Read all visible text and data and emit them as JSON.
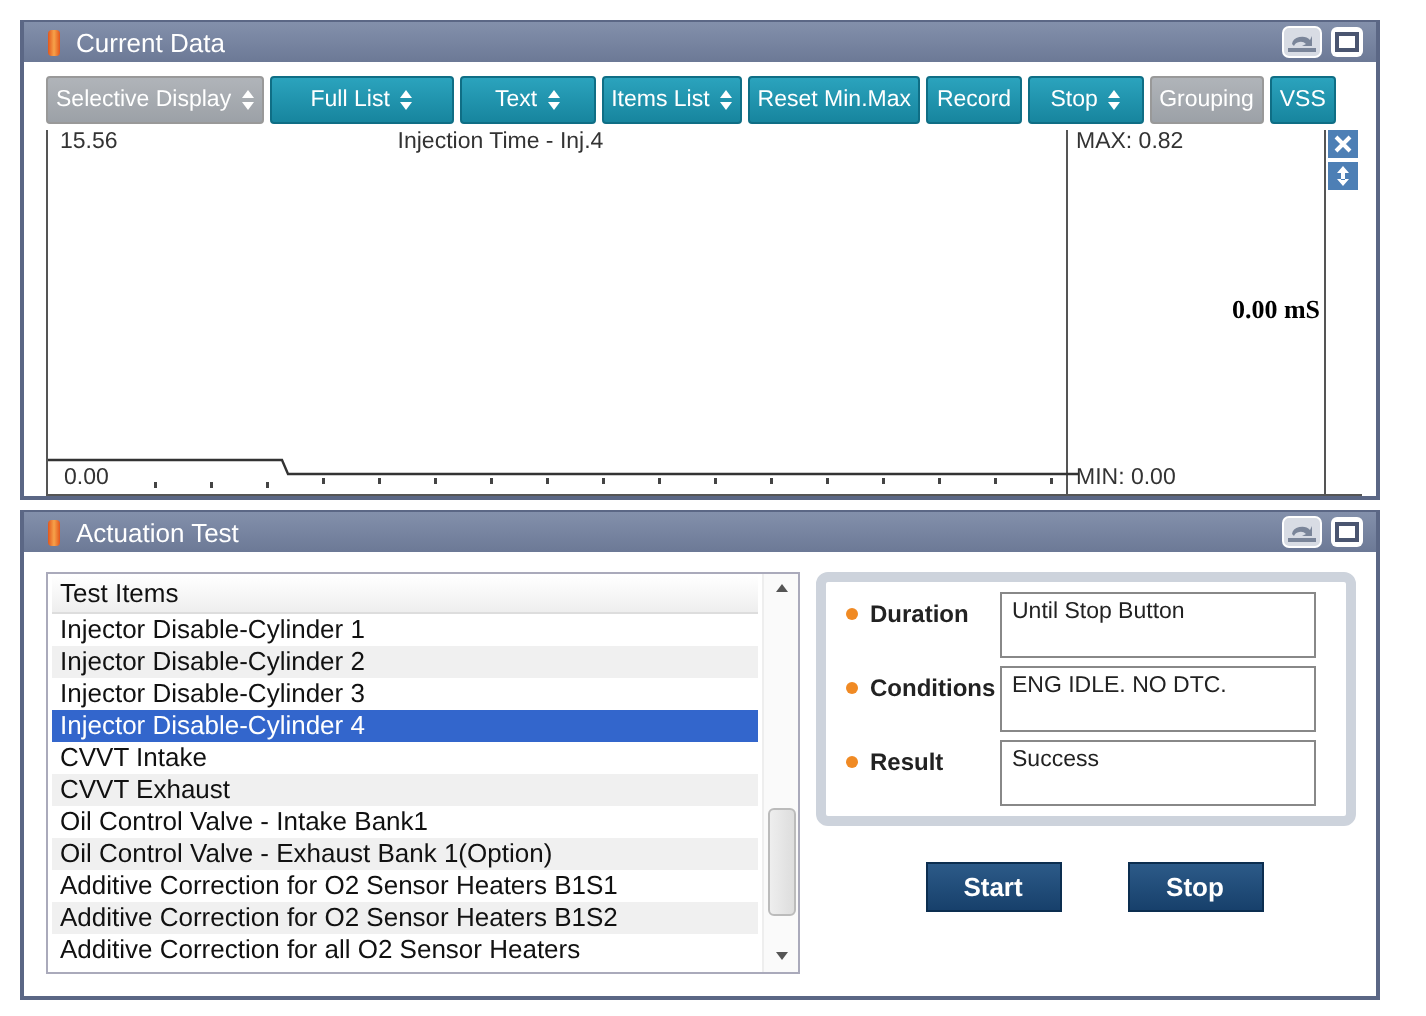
{
  "current_data": {
    "title": "Current Data",
    "toolbar": [
      {
        "label": "Selective Display",
        "dropdown": true,
        "disabled": true
      },
      {
        "label": "Full List",
        "dropdown": true,
        "disabled": false
      },
      {
        "label": "Text",
        "dropdown": true,
        "disabled": false
      },
      {
        "label": "Items List",
        "dropdown": true,
        "disabled": false
      },
      {
        "label": "Reset Min.Max",
        "dropdown": false,
        "disabled": false
      },
      {
        "label": "Record",
        "dropdown": false,
        "disabled": false
      },
      {
        "label": "Stop",
        "dropdown": true,
        "disabled": false
      },
      {
        "label": "Grouping",
        "dropdown": false,
        "disabled": true
      },
      {
        "label": "VSS",
        "dropdown": false,
        "disabled": false
      }
    ],
    "graph": {
      "top_reading": "15.56",
      "name": "Injection Time - Inj.4",
      "bottom_reading": "0.00",
      "max": "MAX: 0.82",
      "value": "0.00 mS",
      "min": "MIN: 0.00"
    }
  },
  "actuation_test": {
    "title": "Actuation Test",
    "list": {
      "header": "Test Items",
      "items": [
        {
          "label": "Injector Disable-Cylinder 1",
          "selected": false
        },
        {
          "label": "Injector Disable-Cylinder 2",
          "selected": false
        },
        {
          "label": "Injector Disable-Cylinder 3",
          "selected": false
        },
        {
          "label": "Injector Disable-Cylinder 4",
          "selected": true
        },
        {
          "label": "CVVT Intake",
          "selected": false
        },
        {
          "label": "CVVT Exhaust",
          "selected": false
        },
        {
          "label": "Oil Control Valve - Intake Bank1",
          "selected": false
        },
        {
          "label": "Oil Control Valve - Exhaust Bank 1(Option)",
          "selected": false
        },
        {
          "label": "Additive Correction for O2 Sensor Heaters B1S1",
          "selected": false
        },
        {
          "label": "Additive Correction for O2 Sensor Heaters B1S2",
          "selected": false
        },
        {
          "label": "Additive Correction for all O2 Sensor Heaters",
          "selected": false
        }
      ]
    },
    "details": [
      {
        "label": "Duration",
        "value": "Until Stop Button"
      },
      {
        "label": "Conditions",
        "value": "ENG IDLE. NO DTC."
      },
      {
        "label": "Result",
        "value": "Success"
      }
    ],
    "buttons": [
      "Start",
      "Stop"
    ]
  }
}
